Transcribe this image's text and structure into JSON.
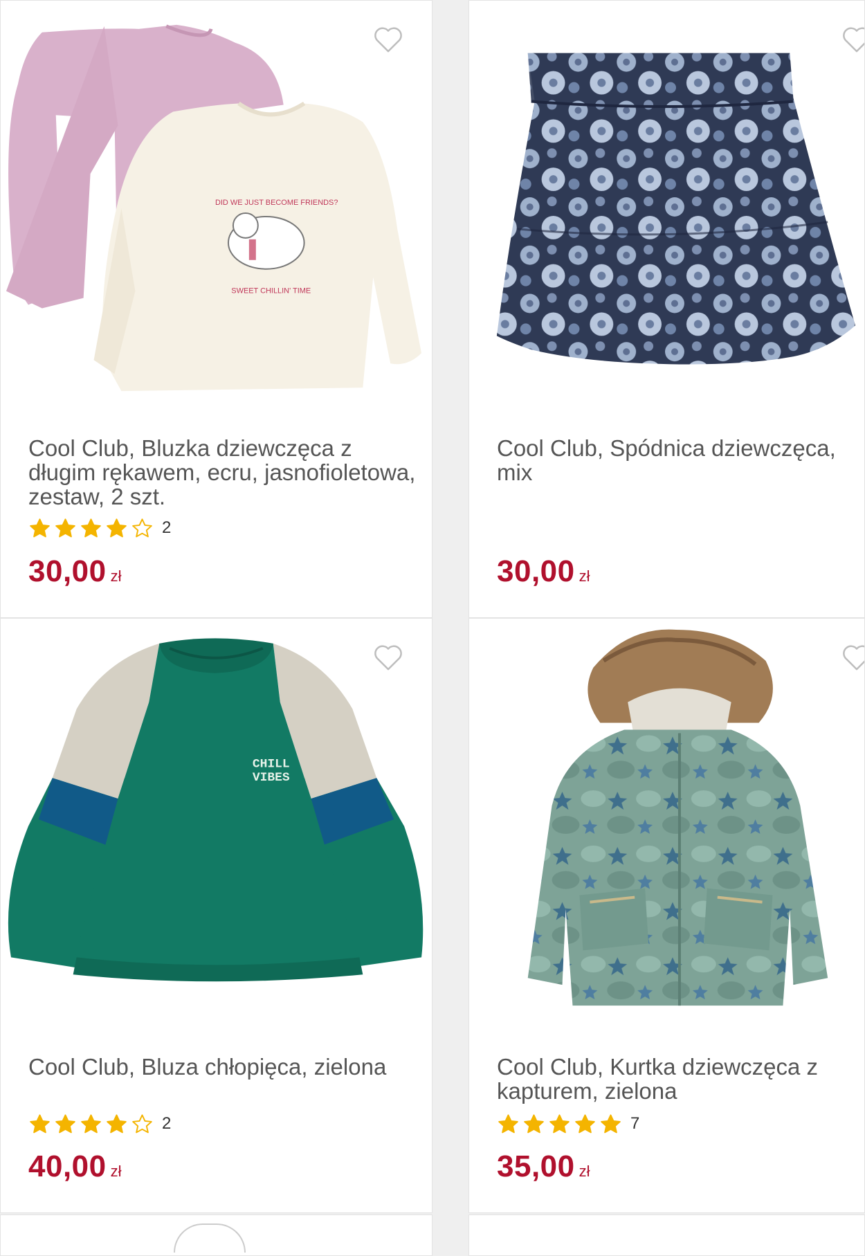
{
  "colors": {
    "price": "#b0102d",
    "star": "#f4b400",
    "background": "#efefef",
    "card": "#ffffff"
  },
  "products": [
    {
      "title": "Cool Club, Bluzka dziewczęca z długim rękawem, ecru, jasnofioletowa, zestaw, 2 szt.",
      "rating": 4,
      "review_count": "2",
      "price": "30,00",
      "currency": "zł",
      "shirt_print_top": "DID WE JUST BECOME FRIENDS?",
      "shirt_print_bottom": "SWEET CHILLIN' TIME"
    },
    {
      "title": "Cool Club, Spódnica dziewczęca, mix",
      "price": "30,00",
      "currency": "zł"
    },
    {
      "title": "Cool Club, Bluza chłopięca, zielona",
      "rating": 4,
      "review_count": "2",
      "price": "40,00",
      "currency": "zł",
      "print_line1": "CHILL",
      "print_line2": "VIBES"
    },
    {
      "title": "Cool Club, Kurtka dziewczęca z kapturem, zielona",
      "rating": 5,
      "review_count": "7",
      "price": "35,00",
      "currency": "zł"
    }
  ]
}
